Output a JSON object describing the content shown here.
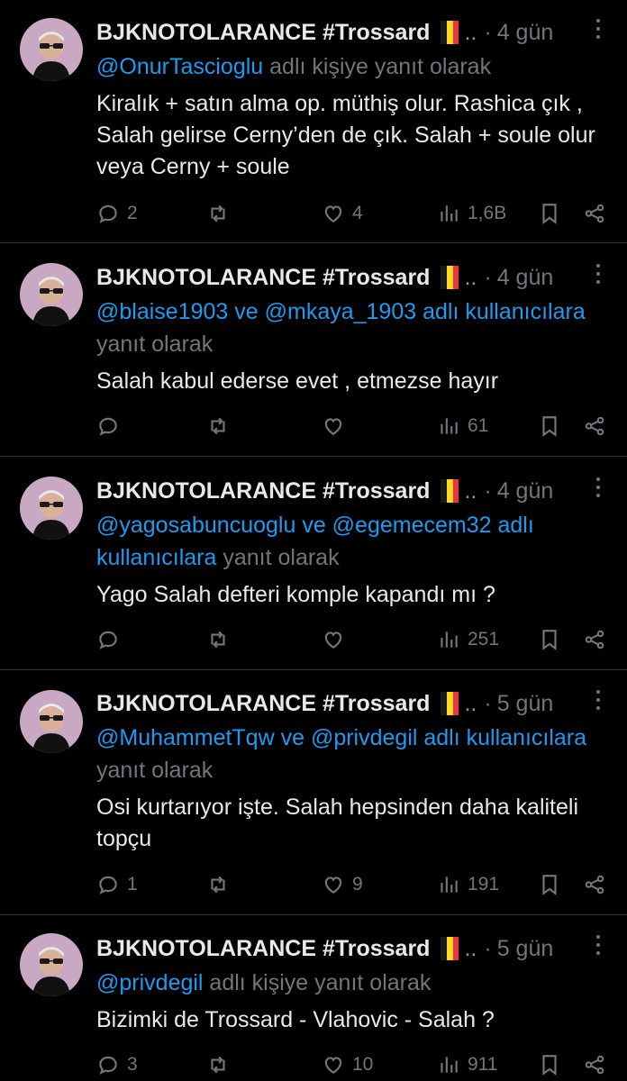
{
  "tweets": [
    {
      "author": "BJKNOTOLARANCE #Trossard",
      "truncation": "..",
      "separator": "·",
      "time": "4 gün",
      "reply_parts": [
        "@OnurTascioglu",
        " adlı kişiye yanıt olarak"
      ],
      "text": "Kiralık + satın alma op. müthiş olur. Rashica çık , Salah gelirse Cerny’den de çık. Salah + soule olur veya Cerny + soule",
      "replies": "2",
      "retweets": "",
      "likes": "4",
      "views": "1,6B"
    },
    {
      "author": "BJKNOTOLARANCE #Trossard",
      "truncation": "..",
      "separator": "·",
      "time": "4 gün",
      "reply_parts": [
        "@blaise1903 ve @mkaya_1903 adlı kullanıcılara",
        " yanıt olarak"
      ],
      "text": "Salah kabul ederse evet , etmezse hayır",
      "replies": "",
      "retweets": "",
      "likes": "",
      "views": "61"
    },
    {
      "author": "BJKNOTOLARANCE #Trossard",
      "truncation": "..",
      "separator": "·",
      "time": "4 gün",
      "reply_parts": [
        "@yagosabuncuoglu ve @egemecem32 adlı kullanıcılara",
        " yanıt olarak"
      ],
      "text": "Yago Salah defteri komple kapandı mı ?",
      "replies": "",
      "retweets": "",
      "likes": "",
      "views": "251"
    },
    {
      "author": "BJKNOTOLARANCE #Trossard",
      "truncation": "..",
      "separator": "·",
      "time": "5 gün",
      "reply_parts": [
        "@MuhammetTqw ve @privdegil adlı kullanıcılara",
        " yanıt olarak"
      ],
      "text": "Osi kurtarıyor işte.  Salah hepsinden daha kaliteli topçu",
      "replies": "1",
      "retweets": "",
      "likes": "9",
      "views": "191"
    },
    {
      "author": "BJKNOTOLARANCE #Trossard",
      "truncation": "..",
      "separator": "·",
      "time": "5 gün",
      "reply_parts": [
        "@privdegil",
        " adlı kişiye yanıt olarak"
      ],
      "text": "Bizimki de Trossard - Vlahovic - Salah ?",
      "replies": "3",
      "retweets": "",
      "likes": "10",
      "views": "911"
    }
  ],
  "flag_colors": [
    "#1a1a1a",
    "#fdda24",
    "#ef3340"
  ],
  "colors": {
    "mention": "#1d9bf0",
    "muted": "#71767b",
    "text": "#e7e9ea"
  },
  "icons": [
    "reply-icon",
    "retweet-icon",
    "like-icon",
    "views-icon",
    "bookmark-icon",
    "share-icon",
    "more-icon"
  ]
}
